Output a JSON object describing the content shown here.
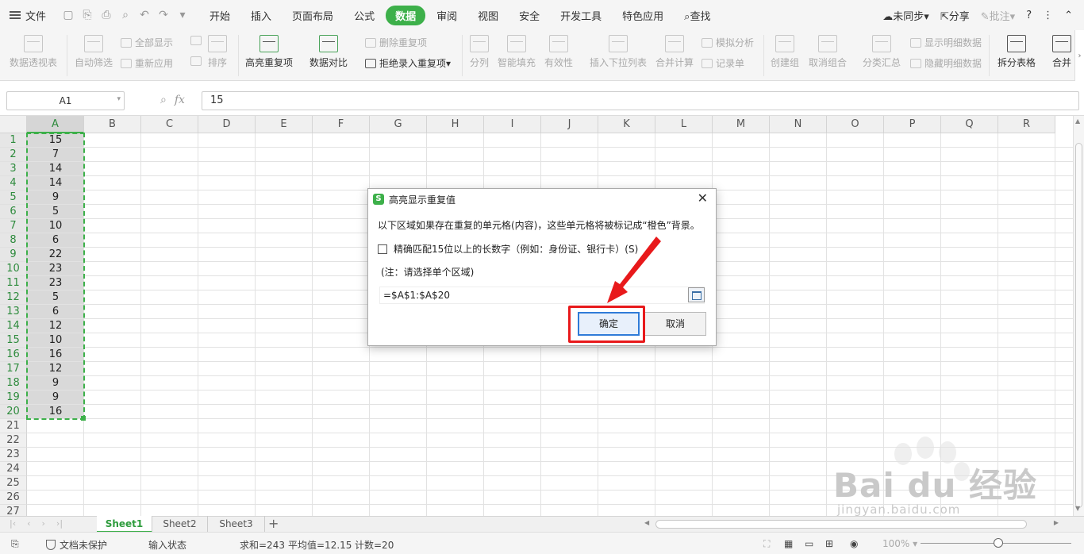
{
  "menubar": {
    "file_label": "文件",
    "tabs": [
      "开始",
      "插入",
      "页面布局",
      "公式",
      "数据",
      "审阅",
      "视图",
      "安全",
      "开发工具",
      "特色应用"
    ],
    "active_tab": "数据",
    "search_label": "查找",
    "sync_label": "未同步",
    "share_label": "分享",
    "comment_label": "批注",
    "help_label": "?"
  },
  "ribbon": {
    "pivot": "数据透视表",
    "autofilter": "自动筛选",
    "show_all": "全部显示",
    "reapply": "重新应用",
    "sort": "排序",
    "highlight_dup": "高亮重复项",
    "compare": "数据对比",
    "delete_dup": "删除重复项",
    "reject_dup": "拒绝录入重复项",
    "split": "分列",
    "smart_fill": "智能填充",
    "validity": "有效性",
    "insert_dropdown": "插入下拉列表",
    "merge_calc": "合并计算",
    "simulate": "模拟分析",
    "record": "记录单",
    "create_group": "创建组",
    "ungroup": "取消组合",
    "subtotal": "分类汇总",
    "show_detail": "显示明细数据",
    "hide_detail": "隐藏明细数据",
    "split_table": "拆分表格",
    "merge": "合并"
  },
  "formula_bar": {
    "name_box": "A1",
    "fx": "fx",
    "value": "15"
  },
  "grid": {
    "columns": [
      "A",
      "B",
      "C",
      "D",
      "E",
      "F",
      "G",
      "H",
      "I",
      "J",
      "K",
      "L",
      "M",
      "N",
      "O",
      "P",
      "Q",
      "R"
    ],
    "row_numbers": [
      "1",
      "2",
      "3",
      "4",
      "5",
      "6",
      "7",
      "8",
      "9",
      "10",
      "11",
      "12",
      "13",
      "14",
      "15",
      "16",
      "17",
      "18",
      "19",
      "20",
      "21",
      "22",
      "23",
      "24",
      "25",
      "26",
      "27"
    ],
    "column_a_values": [
      "15",
      "7",
      "14",
      "14",
      "9",
      "5",
      "10",
      "6",
      "22",
      "23",
      "23",
      "5",
      "6",
      "12",
      "10",
      "16",
      "12",
      "9",
      "9",
      "16"
    ]
  },
  "sheets": {
    "tabs": [
      "Sheet1",
      "Sheet2",
      "Sheet3"
    ],
    "active": "Sheet1",
    "add": "+"
  },
  "statusbar": {
    "protect": "文档未保护",
    "input_state": "输入状态",
    "sum": "求和=243",
    "avg": "平均值=12.15",
    "count": "计数=20",
    "zoom": "100%"
  },
  "dialog": {
    "title": "高亮显示重复值",
    "logo": "S",
    "close": "✕",
    "description": "以下区域如果存在重复的单元格(内容)，这些单元格将被标记成“橙色”背景。",
    "checkbox_label": "精确匹配15位以上的长数字（例如：身份证、银行卡）(S)",
    "note": "(注：请选择单个区域)",
    "range": "=$A$1:$A$20",
    "ok_label": "确定",
    "cancel_label": "取消"
  },
  "watermark": {
    "brand": "Bai du 经验",
    "url": "jingyan.baidu.com"
  },
  "colors": {
    "accent_green": "#3db04a",
    "highlight_red": "#e8191b",
    "ok_border": "#2f7bd8"
  }
}
